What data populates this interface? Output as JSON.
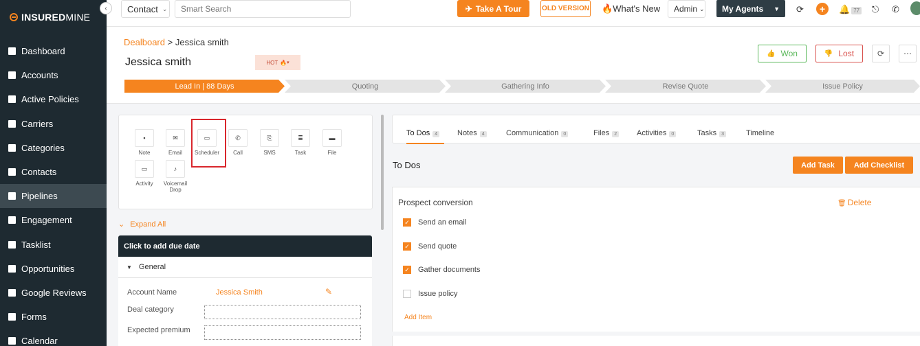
{
  "brand": {
    "part1": "INSURED",
    "part2": "MINE"
  },
  "sidebar": {
    "items": [
      {
        "label": "Dashboard"
      },
      {
        "label": "Accounts"
      },
      {
        "label": "Active Policies"
      },
      {
        "label": "Carriers"
      },
      {
        "label": "Categories"
      },
      {
        "label": "Contacts"
      },
      {
        "label": "Pipelines"
      },
      {
        "label": "Engagement"
      },
      {
        "label": "Tasklist"
      },
      {
        "label": "Opportunities"
      },
      {
        "label": "Google Reviews"
      },
      {
        "label": "Forms"
      },
      {
        "label": "Calendar"
      }
    ],
    "active": "Pipelines"
  },
  "topbar": {
    "contact_select": "Contact",
    "search_placeholder": "Smart Search",
    "take_tour": "Take A Tour",
    "old_version": "OLD VERSION",
    "whats_new": "What's New",
    "admin": "Admin",
    "my_agents": "My Agents",
    "notif_count": "77"
  },
  "header": {
    "breadcrumb_link": "Dealboard",
    "breadcrumb_sep": ">",
    "breadcrumb_current": "Jessica smith",
    "title": "Jessica smith",
    "hot_label": "HOT",
    "won": "Won",
    "lost": "Lost"
  },
  "stages": [
    {
      "label": "Lead In | 88 Days"
    },
    {
      "label": "Quoting"
    },
    {
      "label": "Gathering Info"
    },
    {
      "label": "Revise Quote"
    },
    {
      "label": "Issue Policy"
    }
  ],
  "actions": [
    {
      "label": "Note"
    },
    {
      "label": "Email"
    },
    {
      "label": "Scheduler"
    },
    {
      "label": "Call"
    },
    {
      "label": "SMS"
    },
    {
      "label": "Task"
    },
    {
      "label": "File"
    },
    {
      "label": "Activity"
    },
    {
      "label": "Voicemail Drop"
    }
  ],
  "left": {
    "expand_all": "Expand All",
    "due_date": "Click to add due date",
    "general": "General",
    "fields": [
      {
        "label": "Account Name",
        "value": "Jessica Smith"
      },
      {
        "label": "Deal category",
        "value": ""
      },
      {
        "label": "Expected premium",
        "value": ""
      }
    ]
  },
  "tabs": [
    {
      "label": "To Dos",
      "count": "4"
    },
    {
      "label": "Notes",
      "count": "4"
    },
    {
      "label": "Communication",
      "count": "0"
    },
    {
      "label": "Files",
      "count": "2"
    },
    {
      "label": "Activities",
      "count": "0"
    },
    {
      "label": "Tasks",
      "count": "3"
    },
    {
      "label": "Timeline",
      "count": ""
    }
  ],
  "todos": {
    "title": "To Dos",
    "add_task": "Add Task",
    "add_checklist": "Add Checklist",
    "checklist_title": "Prospect conversion",
    "delete": "Delete",
    "items": [
      {
        "label": "Send an email",
        "checked": true
      },
      {
        "label": "Send quote",
        "checked": true
      },
      {
        "label": "Gather documents",
        "checked": true
      },
      {
        "label": "Issue policy",
        "checked": false
      }
    ],
    "add_item": "Add Item"
  },
  "colors": {
    "accent": "#f5841f",
    "sidebar_bg": "#1e2a31",
    "won": "#5cb85c",
    "lost": "#d9534f",
    "highlight": "#d9262c"
  }
}
